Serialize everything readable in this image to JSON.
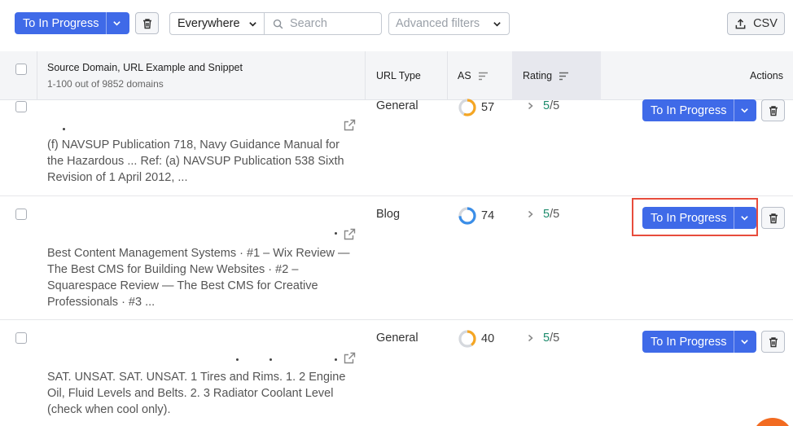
{
  "toolbar": {
    "bulk_action_label": "To In Progress",
    "scope_select_value": "Everywhere",
    "search_placeholder": "Search",
    "advanced_filters_label": "Advanced filters",
    "export_label": "CSV"
  },
  "table": {
    "columns": {
      "source": "Source Domain, URL Example and Snippet",
      "source_sub": "1-100 out of 9852 domains",
      "url_type": "URL Type",
      "as": "AS",
      "rating": "Rating",
      "actions": "Actions"
    },
    "rows": [
      {
        "snippet": "(f) NAVSUP Publication 718, Navy Guidance Manual for the Hazardous ... Ref: (a) NAVSUP Publication 538 Sixth Revision of 1 April 2012, ...",
        "url_type": "General",
        "as": "57",
        "as_fraction": 0.57,
        "rating": "5",
        "rating_total": "/5",
        "action_label": "To In Progress"
      },
      {
        "snippet": "Best Content Management Systems · #1 – Wix Review — The Best CMS for Building New Websites · #2 – Squarespace Review — The Best CMS for Creative Professionals · #3 ...",
        "url_type": "Blog",
        "as": "74",
        "as_fraction": 0.74,
        "rating": "5",
        "rating_total": "/5",
        "action_label": "To In Progress"
      },
      {
        "snippet": "SAT. UNSAT. SAT. UNSAT. 1 Tires and Rims. 1. 2 Engine Oil, Fluid Levels and Belts. 2. 3 Radiator Coolant Level (check when cool only).",
        "url_type": "General",
        "as": "40",
        "as_fraction": 0.4,
        "rating": "5",
        "rating_total": "/5",
        "action_label": "To In Progress"
      }
    ]
  },
  "colors": {
    "primary": "#3f6ae8",
    "as_low": "#f5a623",
    "as_high": "#3b8ee8",
    "as_track": "#d5d8dd",
    "rating": "#1b8a6b",
    "highlight": "#e74c3c"
  }
}
